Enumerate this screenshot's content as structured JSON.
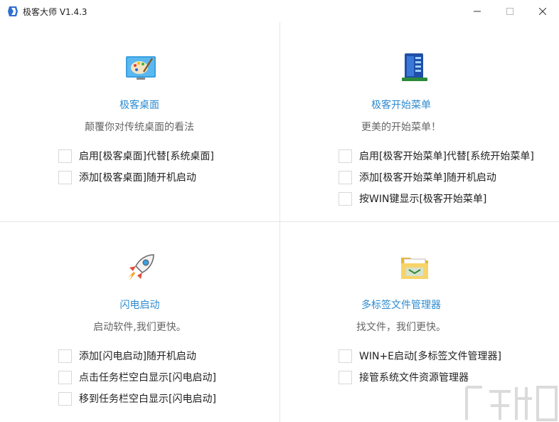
{
  "window": {
    "title": "极客大师 V1.4.3"
  },
  "panels": {
    "desktop": {
      "icon": "palette-icon",
      "title": "极客桌面",
      "subtitle": "颠覆你对传统桌面的看法",
      "options": [
        "启用[极客桌面]代替[系统桌面]",
        "添加[极客桌面]随开机启动"
      ]
    },
    "start_menu": {
      "icon": "start-menu-icon",
      "title": "极客开始菜单",
      "subtitle": "更美的开始菜单！",
      "options": [
        "启用[极客开始菜单]代替[系统开始菜单]",
        "添加[极客开始菜单]随开机启动",
        "按WIN键显示[极客开始菜单]"
      ]
    },
    "launcher": {
      "icon": "rocket-icon",
      "title": "闪电启动",
      "subtitle": "启动软件,我们更快。",
      "options": [
        "添加[闪电启动]随开机启动",
        "点击任务栏空白显示[闪电启动]",
        "移到任务栏空白显示[闪电启动]"
      ]
    },
    "file_manager": {
      "icon": "folder-icon",
      "title": "多标签文件管理器",
      "subtitle": "找文件，我们更快。",
      "options": [
        "WIN+E启动[多标签文件管理器]",
        "接管系统文件资源管理器"
      ]
    }
  },
  "colors": {
    "accent": "#2f8bd0",
    "divider": "#e5e5e5"
  }
}
